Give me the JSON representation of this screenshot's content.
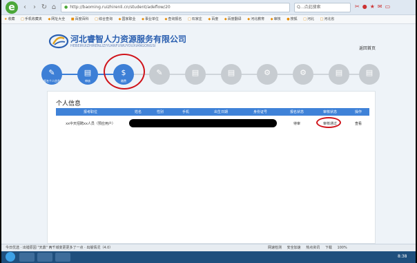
{
  "browser": {
    "logo": "e",
    "url": "http://baoming.ruizhirenli.cn/student/adeflow/20",
    "search_placeholder": "Q...点此搜索",
    "favorites": [
      "收藏",
      "手机收藏夹",
      "网址大全",
      "百度百科",
      "综合查询",
      "国家职业",
      "事业单位",
      "查询报名",
      "石家庄",
      "百度",
      "百度翻译",
      "河北教育",
      "审核",
      "搜狐",
      "河北",
      "河北省"
    ]
  },
  "site": {
    "company_name": "河北睿智人力资源服务有限公司",
    "company_en": "HEBEIRUIZHIRENLIZIYUANFUWUYOUXIANGONGSI",
    "back_home": "返回首页"
  },
  "steps": [
    {
      "label": "报名个人信息",
      "state": "done",
      "icon": "edit-icon"
    },
    {
      "label": "审核",
      "state": "done",
      "icon": "document-icon"
    },
    {
      "label": "缴费",
      "state": "current",
      "icon": "money-bag-icon"
    },
    {
      "label": "",
      "state": "todo",
      "icon": "edit-icon"
    },
    {
      "label": "",
      "state": "todo",
      "icon": "document-icon"
    },
    {
      "label": "",
      "state": "todo",
      "icon": "document-icon"
    },
    {
      "label": "",
      "state": "todo",
      "icon": "gear-icon"
    },
    {
      "label": "",
      "state": "todo",
      "icon": "gear-icon"
    },
    {
      "label": "",
      "state": "todo",
      "icon": "document-icon"
    },
    {
      "label": "",
      "state": "todo",
      "icon": "document-icon"
    }
  ],
  "panel": {
    "title": "个人信息",
    "columns": [
      "报考职位",
      "姓名",
      "性别",
      "手机",
      "出生日期",
      "身份证号",
      "报名状态",
      "审核状态",
      "操作"
    ],
    "row": {
      "position": "xx中天招聘xx人员（预应用户）",
      "status": "待审",
      "review_status": "审核通过",
      "action": "查看"
    }
  },
  "statusbar": {
    "left": "今日优选 · 出错原因 \"天鼎\" 两千城变更更多了一点 · 出版情况（4.0）",
    "right": [
      "网速检测",
      "安全加速",
      "热点资讯",
      "下载",
      "100%"
    ]
  },
  "taskbar": {
    "clock": "8:38"
  },
  "colors": {
    "accent": "#3f82d8",
    "step_done": "#3d7fd6",
    "step_todo": "#c7ccd1",
    "annotation_red": "#d0131a"
  }
}
